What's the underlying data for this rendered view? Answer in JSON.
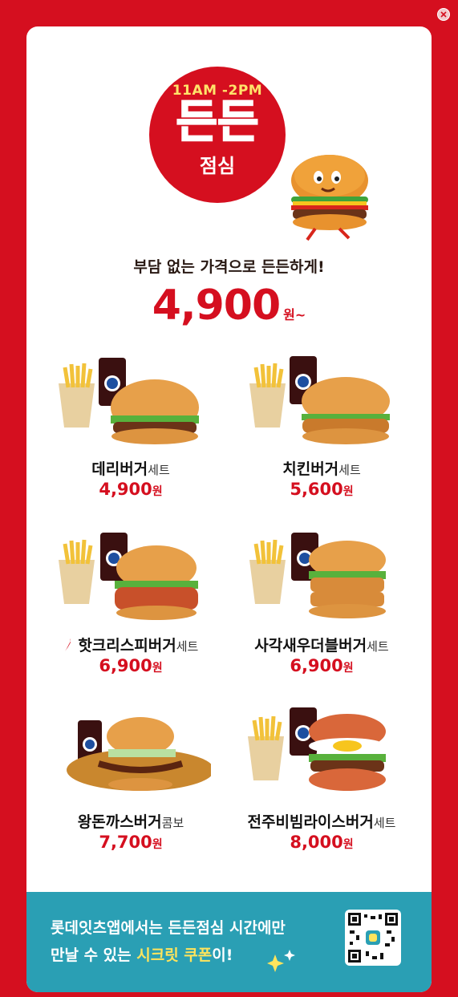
{
  "hero": {
    "time": "11AM -2PM",
    "title": "든든",
    "subtitle": "점심"
  },
  "tagline": "부담 없는 가격으로 든든하게!",
  "start_price": {
    "value": "4,900",
    "unit": "원~"
  },
  "menu": [
    {
      "name": "데리버거",
      "suffix": "세트",
      "price": "4,900",
      "won": "원"
    },
    {
      "name": "치킨버거",
      "suffix": "세트",
      "price": "5,600",
      "won": "원"
    },
    {
      "name": "핫크리스피버거",
      "suffix": "세트",
      "price": "6,900",
      "won": "원"
    },
    {
      "name": "사각새우더블버거",
      "suffix": "세트",
      "price": "6,900",
      "won": "원"
    },
    {
      "name": "왕돈까스버거",
      "suffix": "콤보",
      "price": "7,700",
      "won": "원"
    },
    {
      "name": "전주비빔라이스버거",
      "suffix": "세트",
      "price": "8,000",
      "won": "원"
    }
  ],
  "footer": {
    "line1": "롯데잇츠앱에서는 든든점심 시간에만",
    "line2_prefix": "만날 수 있는 ",
    "line2_highlight": "시크릿 쿠폰",
    "line2_suffix": "이!"
  },
  "icons": [
    "close-icon",
    "burger-mascot-icon",
    "chili-icon",
    "qr-code-icon",
    "sparkle-icon"
  ],
  "colors": {
    "brand_red": "#d50f1f",
    "footer_teal": "#2a9fb4",
    "highlight_yellow": "#ffe45c"
  }
}
